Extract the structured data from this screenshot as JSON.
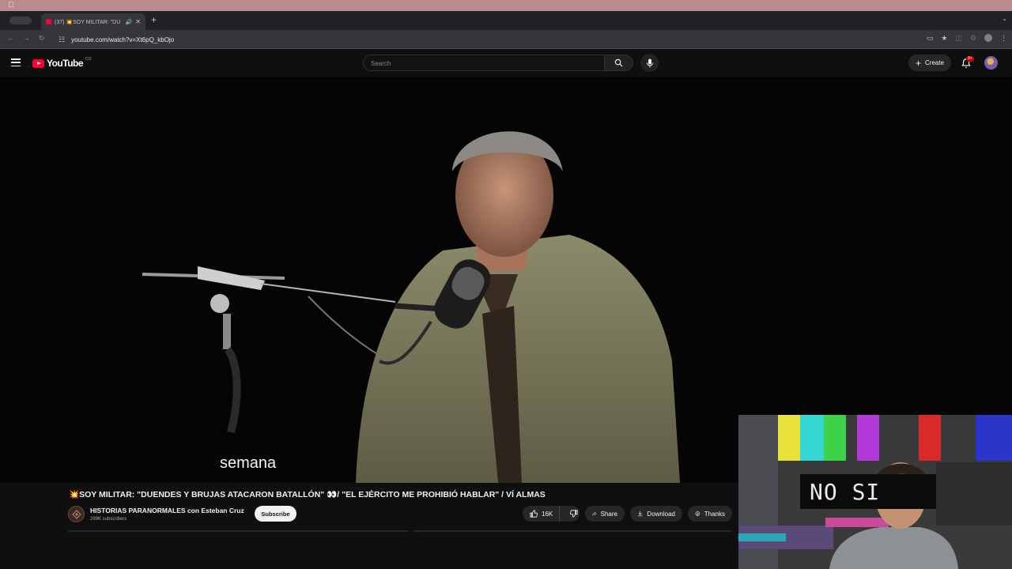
{
  "browser": {
    "tab": {
      "title": "(37) 💥SOY MILITAR: \"DU",
      "favicon": "youtube-favicon-icon",
      "audio_icon": "speaker-icon",
      "close_icon": "close-icon"
    },
    "new_tab_icon": "plus-icon",
    "address": {
      "url": "youtube.com/watch?v=Xt6pQ_kbOjo"
    }
  },
  "youtube": {
    "logo_text": "YouTube",
    "logo_superscript": "CO",
    "search_placeholder": "Search",
    "create_label": "Create",
    "notification_badge": "9+",
    "video": {
      "subtitle": "semana",
      "title": "💥SOY MILITAR: \"DUENDES Y BRUJAS ATACARON BATALLÓN\" 👀/ \"EL EJÉRCITO ME PROHIBIÓ HABLAR\" / VÍ ALMAS",
      "channel_name": "HISTORIAS PARANORMALES con Esteban Cruz",
      "subscribers": "299K subscribers",
      "subscribe_label": "Subscribe",
      "likes": "16K",
      "share_label": "Share",
      "download_label": "Download",
      "thanks_label": "Thanks"
    }
  },
  "webcam_overlay": {
    "text": "NO SI"
  },
  "colors": {
    "youtube_red": "#ff0033",
    "background": "#0f0f0f",
    "pill": "#272727"
  }
}
